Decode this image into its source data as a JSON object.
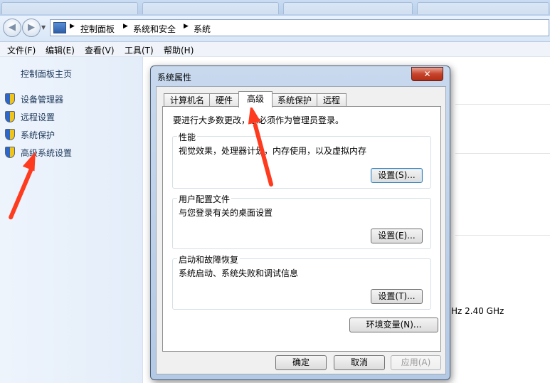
{
  "address": {
    "crumbs": [
      "控制面板",
      "系统和安全",
      "系统"
    ]
  },
  "menu": [
    "文件(F)",
    "编辑(E)",
    "查看(V)",
    "工具(T)",
    "帮助(H)"
  ],
  "sidebar": {
    "home": "控制面板主页",
    "items": [
      {
        "label": "设备管理器",
        "icon": "uac-shield-icon"
      },
      {
        "label": "远程设置",
        "icon": "uac-shield-icon"
      },
      {
        "label": "系统保护",
        "icon": "uac-shield-icon"
      },
      {
        "label": "高级系统设置",
        "icon": "uac-shield-icon"
      }
    ]
  },
  "background": {
    "cpu_speed": "Hz   2.40 GHz"
  },
  "dialog": {
    "title": "系统属性",
    "close": "✕",
    "tabs": [
      "计算机名",
      "硬件",
      "高级",
      "系统保护",
      "远程"
    ],
    "active_tab": "高级",
    "admin_note": "要进行大多数更改，您必须作为管理员登录。",
    "groups": [
      {
        "title": "性能",
        "desc": "视觉效果，处理器计划，内存使用，以及虚拟内存",
        "button": "设置(S)..."
      },
      {
        "title": "用户配置文件",
        "desc": "与您登录有关的桌面设置",
        "button": "设置(E)..."
      },
      {
        "title": "启动和故障恢复",
        "desc": "系统启动、系统失败和调试信息",
        "button": "设置(T)..."
      }
    ],
    "env_button": "环境变量(N)...",
    "ok": "确定",
    "cancel": "取消",
    "apply": "应用(A)"
  },
  "colors": {
    "annotation_arrow": "#ff3b1f",
    "link": "#1e395b"
  }
}
